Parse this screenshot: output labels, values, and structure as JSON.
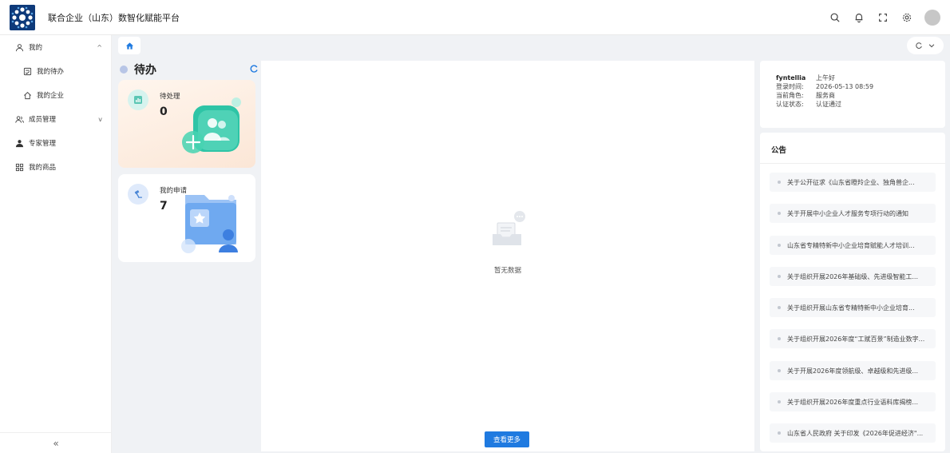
{
  "header": {
    "title": "联合企业（山东）数智化赋能平台",
    "icons": [
      "search-icon",
      "bell-icon",
      "fullscreen-icon",
      "gear-icon",
      "avatar"
    ]
  },
  "sidebar": {
    "items": [
      {
        "label": "我的",
        "icon": "user-icon",
        "caret": "^"
      },
      {
        "label": "我的待办",
        "icon": "todo-icon"
      },
      {
        "label": "我的企业",
        "icon": "home-icon"
      },
      {
        "label": "成员管理",
        "icon": "members-icon",
        "caret": "v"
      },
      {
        "label": "专家管理",
        "icon": "expert-icon"
      },
      {
        "label": "我的商品",
        "icon": "grid-icon"
      }
    ],
    "collapse_label": "«"
  },
  "tabs": {
    "home_icon": "home-icon"
  },
  "todo": {
    "title": "待办",
    "cards": [
      {
        "label": "待处理",
        "count": "0"
      },
      {
        "label": "我的申请",
        "count": "7"
      }
    ]
  },
  "center": {
    "empty_text": "暂无数据",
    "more_button": "查看更多"
  },
  "user": {
    "name": "fyntellia",
    "greeting": "上午好",
    "login_time_label": "登录时间:",
    "login_time": "2026-05-13 08:59",
    "role_label": "当前角色:",
    "role": "服务商",
    "auth_label": "认证状态:",
    "auth": "认证通过"
  },
  "notice": {
    "title": "公告",
    "items": [
      "关于公开征求《山东省瞪羚企业、独角兽企...",
      "关于开展中小企业人才服务专项行动的通知",
      "山东省专精特新中小企业培育赋能人才培训...",
      "关于组织开展2026年基础级、先进级智能工...",
      "关于组织开展山东省专精特新中小企业培育...",
      "关于组织开展2026年度“工赋百景”制造业数字...",
      "关于开展2026年度领航级、卓越级和先进级...",
      "关于组织开展2026年度重点行业语料库揭榜...",
      "山东省人民政府 关于印发《2026年促进经济\"..."
    ]
  },
  "colors": {
    "accent": "#1f7ae0",
    "logo_bg": "#0e3a7a",
    "card1_bg": "#fbe6d6",
    "teal": "#2ec4a6"
  }
}
